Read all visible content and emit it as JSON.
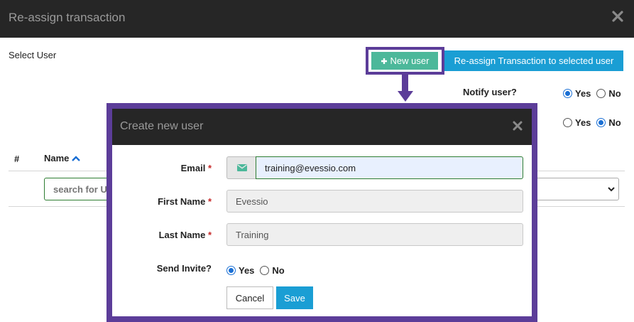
{
  "outer_dialog": {
    "title": "Re-assign transaction",
    "select_user_label": "Select User",
    "new_user_label": "New user",
    "reassign_label": "Re-assign Transaction to selected user",
    "notify_label": "Notify user?",
    "notify_options": [
      {
        "label": "Yes",
        "checked": true
      },
      {
        "label": "No",
        "checked": false
      }
    ],
    "second_options": [
      {
        "label": "Yes",
        "checked": false
      },
      {
        "label": "No",
        "checked": true
      }
    ],
    "table": {
      "hash_header": "#",
      "name_header": "Name",
      "search_placeholder": "search for User"
    }
  },
  "modal": {
    "title": "Create new user",
    "email_label": "Email",
    "email_value": "training@evessio.com",
    "first_name_label": "First Name",
    "first_name_value": "Evessio",
    "last_name_label": "Last Name",
    "last_name_value": "Training",
    "required_mark": "*",
    "send_invite_label": "Send Invite?",
    "invite_options": [
      {
        "label": "Yes",
        "checked": true
      },
      {
        "label": "No",
        "checked": false
      }
    ],
    "cancel_label": "Cancel",
    "save_label": "Save"
  },
  "colors": {
    "header_bg": "#262626",
    "primary": "#1a9ed4",
    "success": "#4cb89a",
    "highlight": "#5c3d99",
    "required": "#c62828"
  },
  "icons": {
    "outer_close": "close-icon",
    "plus": "plus-icon",
    "sort": "sort-up-icon",
    "chevron": "chevron-down-icon",
    "envelope": "envelope-icon",
    "modal_close": "close-icon"
  }
}
